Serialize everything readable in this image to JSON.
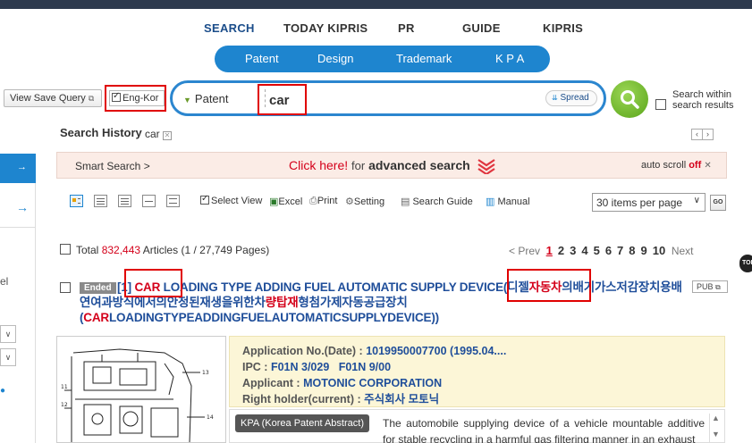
{
  "nav": {
    "items": [
      "SEARCH",
      "TODAY KIPRIS",
      "PR",
      "GUIDE",
      "KIPRIS"
    ],
    "sub_items": [
      "Patent",
      "Design",
      "Trademark",
      "K P A"
    ]
  },
  "search": {
    "view_save_query": "View Save Query",
    "eng_kor": "Eng-Kor",
    "scope": "Patent",
    "query": "car",
    "spread": "Spread",
    "within_label": "Search within search results"
  },
  "history": {
    "label": "Search History",
    "terms": [
      "car"
    ]
  },
  "left_panel": {
    "text": "el"
  },
  "smart": {
    "label": "Smart Search >",
    "click_here": "Click here!",
    "for": "for",
    "advanced": "advanced search",
    "auto_scroll": "auto scroll",
    "off": "off"
  },
  "toolbar": {
    "select_view": "Select View",
    "excel": "Excel",
    "print": "Print",
    "setting": "Setting",
    "search_guide": "Search Guide",
    "manual": "Manual",
    "per_page": "30 items per page",
    "go": "GO"
  },
  "results": {
    "total_label": "Total",
    "total_count": "832,443",
    "articles": "Articles",
    "pages_info": "(1 / 27,749 Pages)",
    "prev": "< Prev",
    "next": "Next",
    "pages": [
      "1",
      "2",
      "3",
      "4",
      "5",
      "6",
      "7",
      "8",
      "9",
      "10"
    ]
  },
  "side_badge": "TOP",
  "result1": {
    "status": "Ended",
    "index": "[1]",
    "title_hl1": "CAR",
    "title_part1": " LOADING TYPE ADDING FUEL AUTOMATIC SUPPLY DEVICE(디젤",
    "title_hl2": "자동차",
    "title_part2": "의배기가스저감장치용배연여과방식에서의안정된재생을위한차",
    "title_hl3": "량탑재",
    "title_part3": "형첨가제자동공급장치 (",
    "title_hl4": "CAR",
    "title_part4": "LOADINGTYPEADDINGFUELAUTOMATICSUPPLYDEVICE))",
    "pub": "PUB",
    "application_label": "Application No.(Date) : ",
    "application_value": "1019950007700 (1995.04....",
    "ipc_label": "IPC : ",
    "ipc_value": "F01N 3/029   F01N 9/00",
    "applicant_label": "Applicant : ",
    "applicant_value": "MOTONIC CORPORATION",
    "holder_label": "Right holder(current) : ",
    "holder_value": "주식회사 모토닉",
    "kpa_tag": "KPA (Korea Patent Abstract)",
    "kpa_text": "The automobile supplying device of a vehicle mountable additive for stable recycling in a harmful gas filtering manner in an exhaust"
  }
}
